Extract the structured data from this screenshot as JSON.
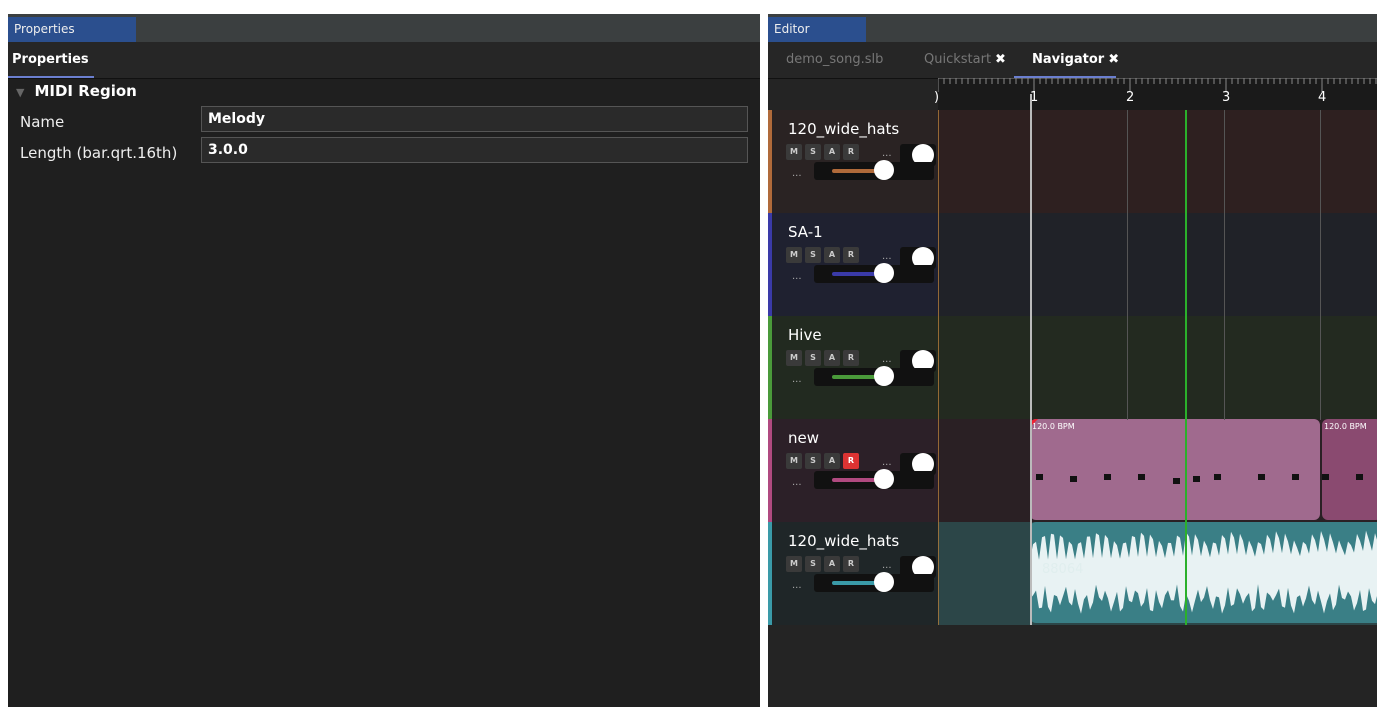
{
  "left_panel": {
    "window_tab": "Properties",
    "sub_tab": "Properties",
    "section_title": "MIDI Region",
    "fields": [
      {
        "label": "Name",
        "value": "Melody"
      },
      {
        "label": "Length (bar.qrt.16th)",
        "value": "3.0.0"
      }
    ]
  },
  "editor": {
    "window_tab": "Editor",
    "tabs": [
      {
        "label": "demo_song.slb",
        "closable": false,
        "active": false
      },
      {
        "label": "Quickstart",
        "closable": true,
        "active": false
      },
      {
        "label": "Navigator",
        "closable": true,
        "active": true
      }
    ],
    "close_glyph": "✖",
    "ruler_labels": [
      ")",
      "1",
      "2",
      "3",
      "4"
    ],
    "track_buttons": [
      "M",
      "S",
      "A",
      "R"
    ],
    "more_glyph": "...",
    "tracks": [
      {
        "name": "120_wide_hats",
        "color": "#b06a3a",
        "record_on": false
      },
      {
        "name": "SA-1",
        "color": "#3a3aa8",
        "record_on": false
      },
      {
        "name": "Hive",
        "color": "#4a9a3a",
        "record_on": false
      },
      {
        "name": "new",
        "color": "#b04a80",
        "record_on": true
      },
      {
        "name": "120_wide_hats",
        "color": "#3a9aa8",
        "record_on": false
      }
    ],
    "midi_regions": [
      {
        "label": "120.0 BPM"
      },
      {
        "label": "120.0 BPM"
      }
    ],
    "audio_region_label": "88064",
    "colors": {
      "playhead": "#2bb02b",
      "midi_region": "#a06a8e",
      "audio_region": "#3a7f86"
    }
  }
}
